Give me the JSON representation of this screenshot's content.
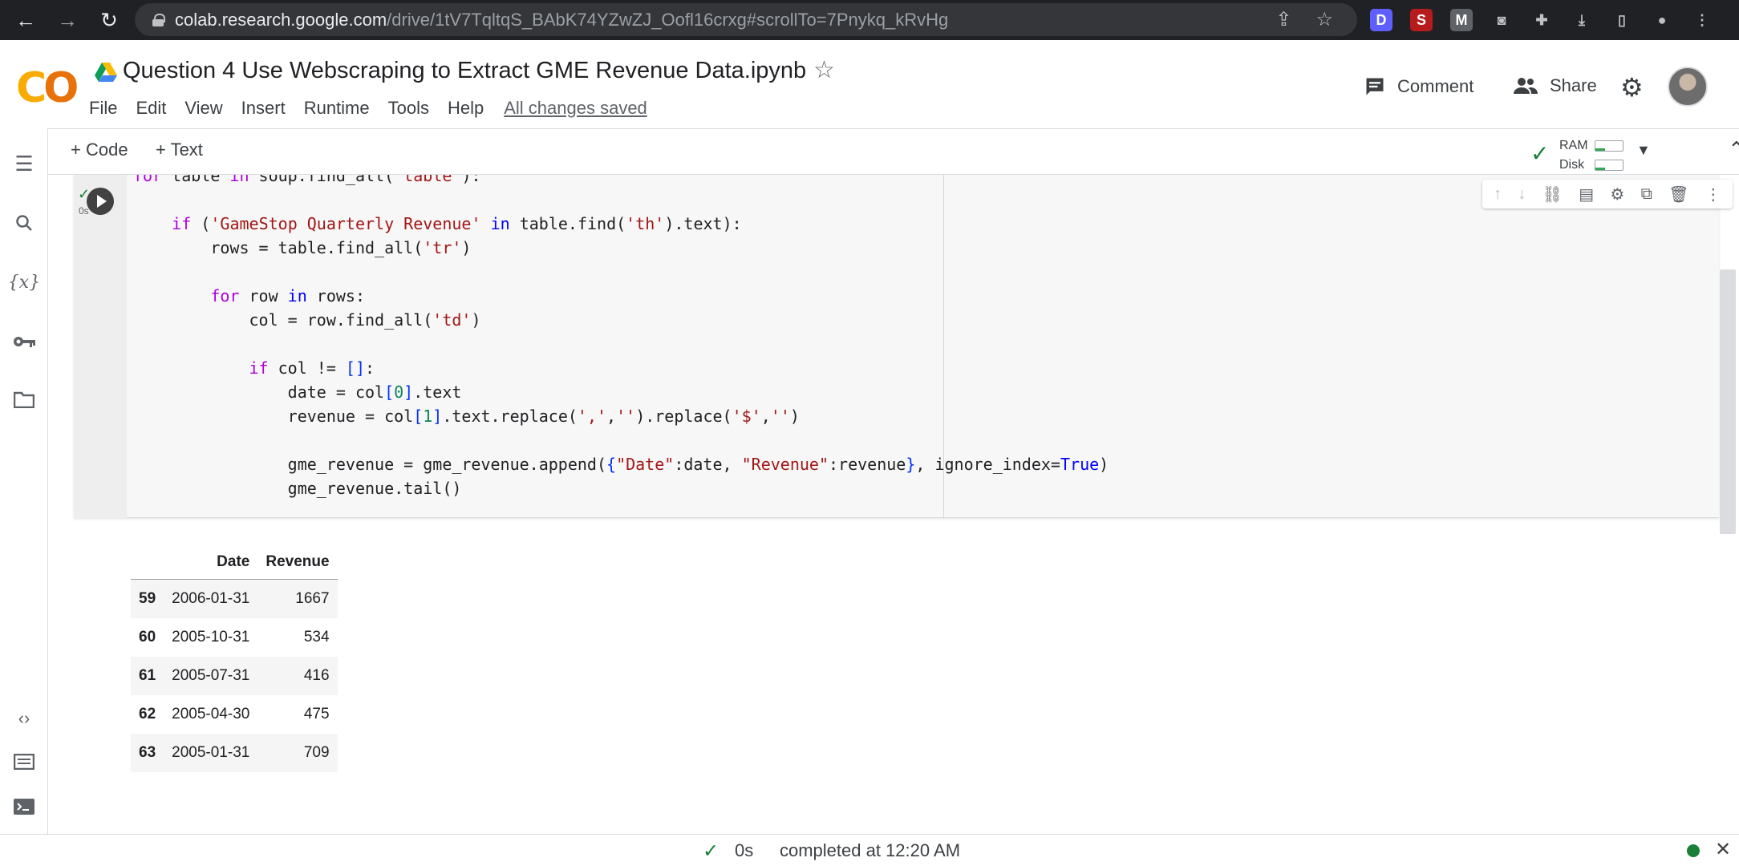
{
  "browser": {
    "back": "←",
    "forward": "→",
    "reload": "↻",
    "url_host": "colab.research.google.com",
    "url_path": "/drive/1tV7TqltqS_BAbK74YZwZJ_Oofl16crxg#scrollTo=7Pnykq_kRvHg",
    "extensions": [
      {
        "name": "D",
        "color": "#5f5fff"
      },
      {
        "name": "S",
        "color": "#b71c1c"
      },
      {
        "name": "M",
        "color": "#5f6368"
      }
    ]
  },
  "header": {
    "title": "Question 4 Use Webscraping to Extract GME Revenue Data.ipynb",
    "menu": [
      "File",
      "Edit",
      "View",
      "Insert",
      "Runtime",
      "Tools",
      "Help"
    ],
    "saved_status": "All changes saved",
    "comment_label": "Comment",
    "share_label": "Share"
  },
  "toolbar": {
    "add_code": "+ Code",
    "add_text": "+ Text",
    "ram_label": "RAM",
    "disk_label": "Disk"
  },
  "cell": {
    "status": "✓",
    "exec_time": "0s",
    "code_lines": [
      "for table in soup.find_all('table'):",
      "",
      "    if ('GameStop Quarterly Revenue' in table.find('th').text):",
      "        rows = table.find_all('tr')",
      "",
      "        for row in rows:",
      "            col = row.find_all('td')",
      "",
      "            if col != []:",
      "                date = col[0].text",
      "                revenue = col[1].text.replace(',','').replace('$','')",
      "",
      "                gme_revenue = gme_revenue.append({\"Date\":date, \"Revenue\":revenue}, ignore_index=True)",
      "                gme_revenue.tail()"
    ]
  },
  "output": {
    "columns": [
      "",
      "Date",
      "Revenue"
    ],
    "rows": [
      {
        "index": "59",
        "date": "2006-01-31",
        "revenue": "1667"
      },
      {
        "index": "60",
        "date": "2005-10-31",
        "revenue": "534"
      },
      {
        "index": "61",
        "date": "2005-07-31",
        "revenue": "416"
      },
      {
        "index": "62",
        "date": "2005-04-30",
        "revenue": "475"
      },
      {
        "index": "63",
        "date": "2005-01-31",
        "revenue": "709"
      }
    ]
  },
  "status_bar": {
    "check": "✓",
    "time": "0s",
    "completed": "completed at 12:20 AM",
    "close": "✕"
  }
}
